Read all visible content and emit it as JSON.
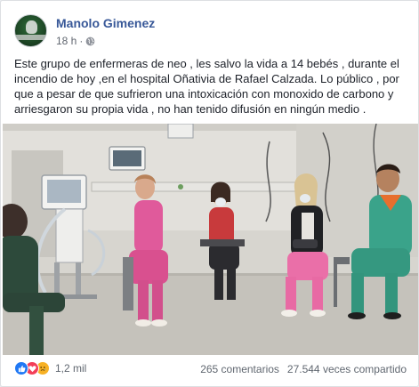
{
  "post": {
    "author": "Manolo Gimenez",
    "time": "18 h",
    "separator": "·",
    "privacy_icon": "globe-icon",
    "text": "Este grupo de enfermeras de neo , les salvo la vida a 14 bebés , durante el incendio de hoy ,en el hospital Oñativia de Rafael Calzada. Lo público , por que a pesar de que sufrieron una intoxicación con monoxido de carbono y arriesgaron su propia vida , no han tenido difusión en ningún medio ."
  },
  "footer": {
    "reaction_icons": [
      "like-icon",
      "love-icon",
      "sad-icon"
    ],
    "reaction_count": "1,2 mil",
    "comments": "265 comentarios",
    "shares": "27.544 veces compartido"
  },
  "colors": {
    "author_link": "#385898",
    "meta_text": "#616770",
    "like": "#2078f4",
    "love": "#f33e58",
    "sad": "#f7b125"
  }
}
